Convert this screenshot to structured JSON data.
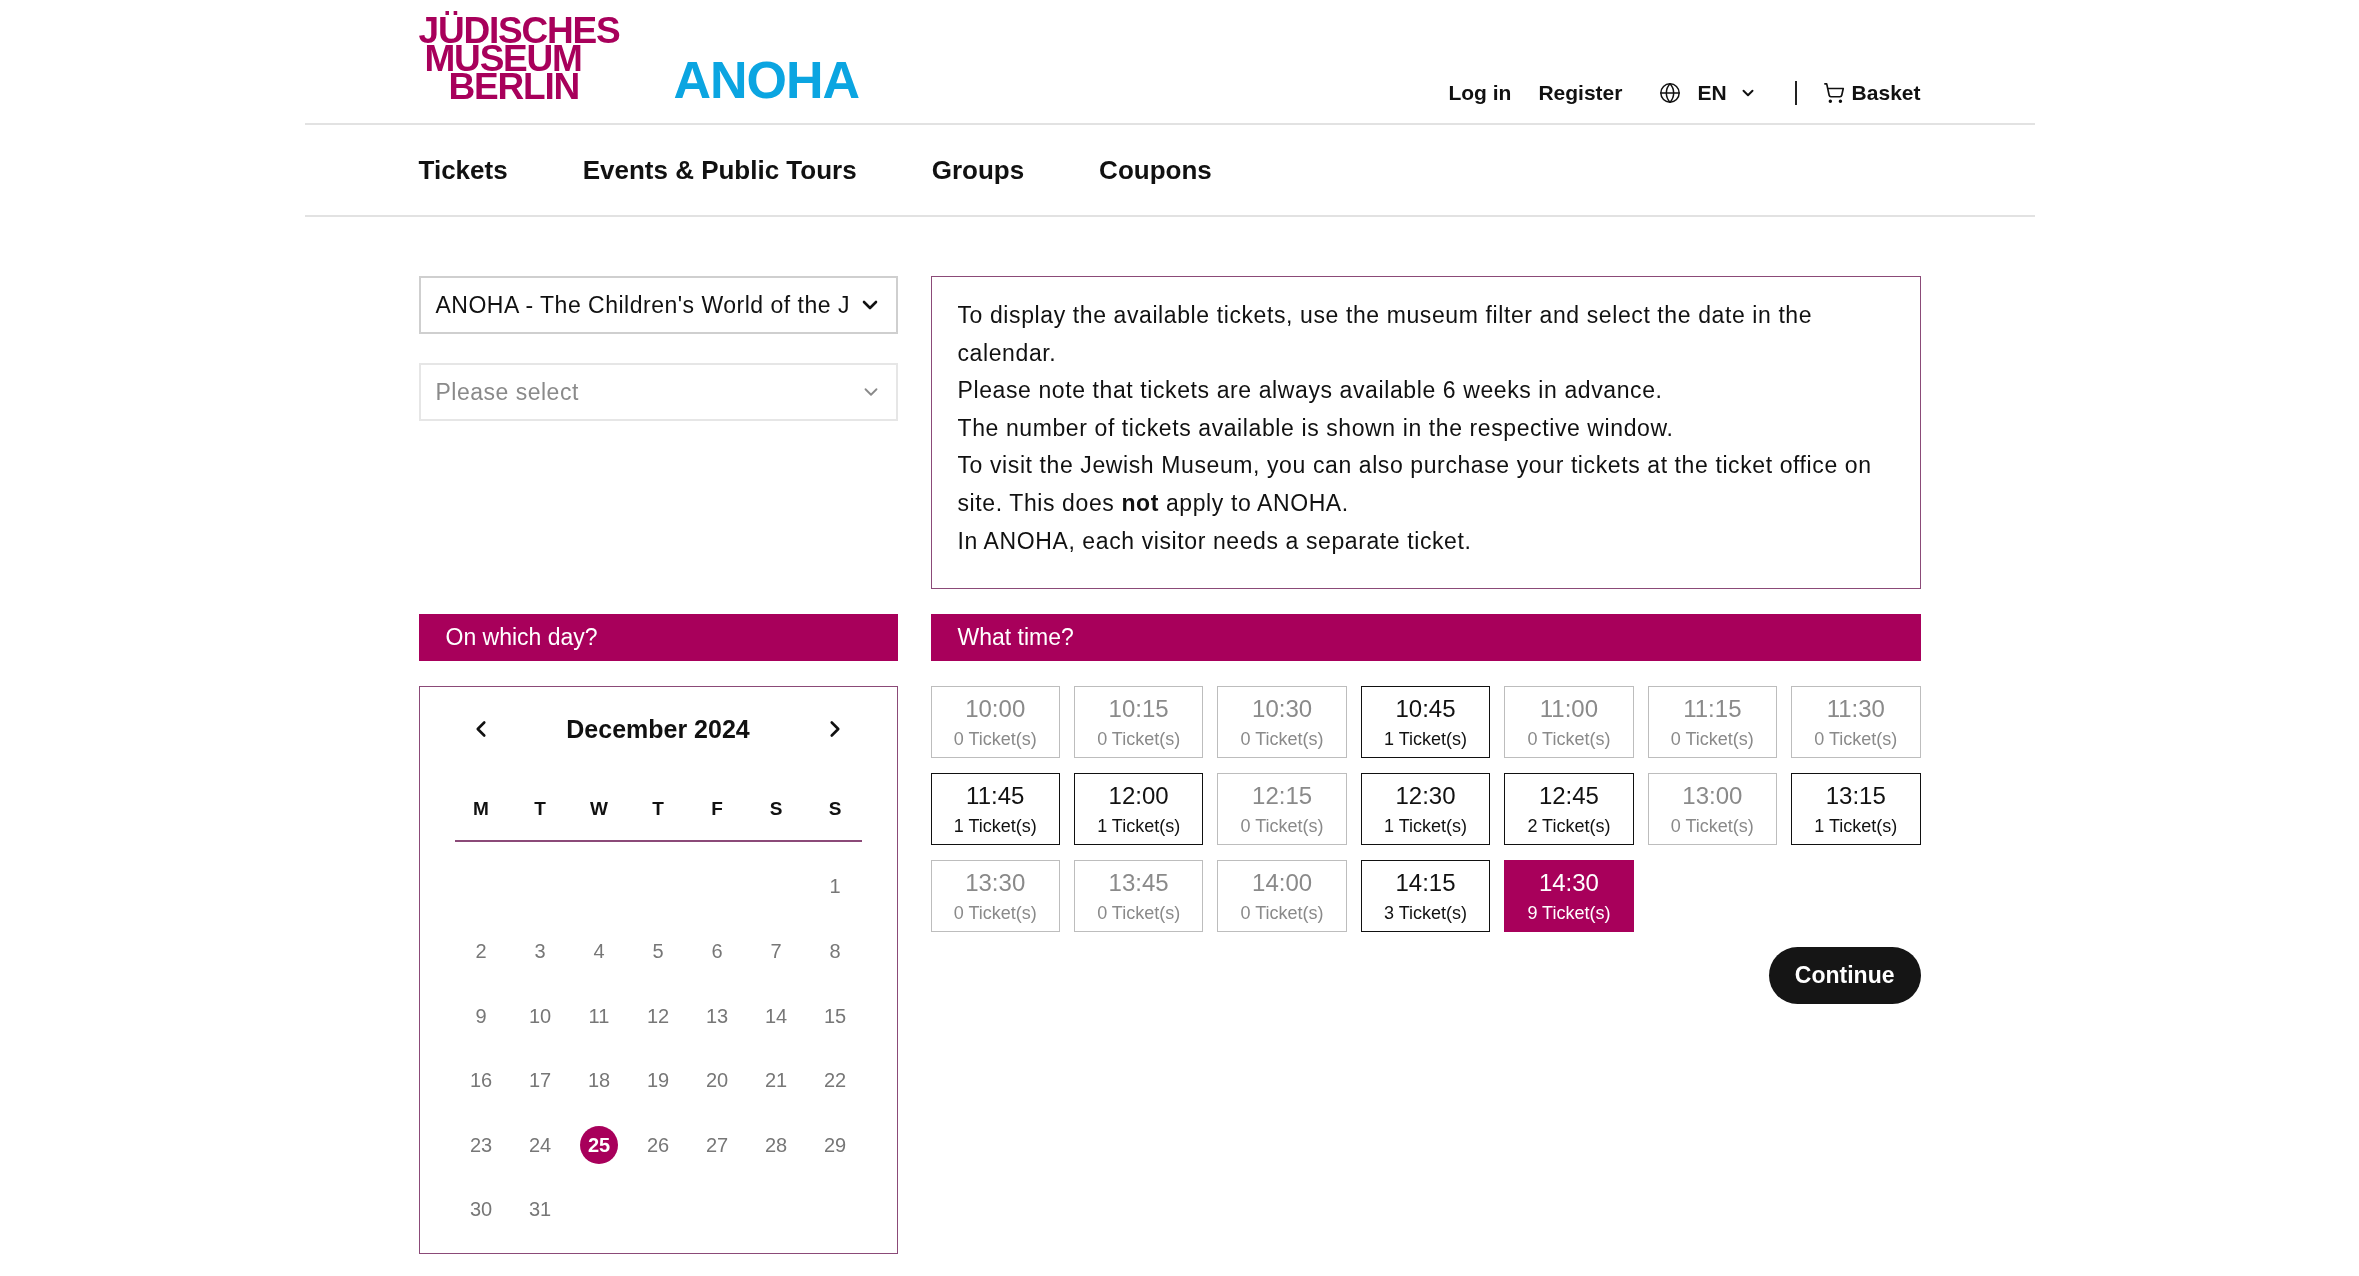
{
  "header": {
    "logo": [
      "JÜDISCHES",
      "MUSEUM",
      "BERLIN"
    ],
    "wordmark": "ANOHA",
    "links": [
      "Log in",
      "Register"
    ],
    "language": "EN",
    "basket": "Basket"
  },
  "nav": {
    "items": [
      "Tickets",
      "Events & Public Tours",
      "Groups",
      "Coupons"
    ]
  },
  "filters": [
    {
      "value": "ANOHA - The Children's World of the J"
    },
    {
      "placeholder": "Please select"
    }
  ],
  "info": {
    "paragraphs": [
      "To display the available tickets, use the museum filter and select the date in the calendar.",
      "Please note that tickets are always available 6 weeks in advance.",
      "The number of tickets available is shown in the respective window.",
      "To visit the Jewish Museum, you can also purchase your tickets at the ticket office on site. This does **not** apply to ANOHA.",
      "In ANOHA, each visitor needs a separate ticket."
    ]
  },
  "day_picker": {
    "title": "On which day?",
    "month": "December 2024",
    "weekdays": [
      "M",
      "T",
      "W",
      "T",
      "F",
      "S",
      "S"
    ],
    "weeks": [
      {
        "days": [
          {
            "day": "1",
            "selected": false
          }
        ]
      },
      {
        "days": [
          {
            "day": "2",
            "selected": false
          },
          {
            "day": "3",
            "selected": false
          },
          {
            "day": "4",
            "selected": false
          },
          {
            "day": "5",
            "selected": false
          },
          {
            "day": "6",
            "selected": false
          },
          {
            "day": "7",
            "selected": false
          },
          {
            "day": "8",
            "selected": false
          }
        ]
      },
      {
        "days": [
          {
            "day": "9",
            "selected": false
          },
          {
            "day": "10",
            "selected": false
          },
          {
            "day": "11",
            "selected": false
          },
          {
            "day": "12",
            "selected": false
          },
          {
            "day": "13",
            "selected": false
          },
          {
            "day": "14",
            "selected": false
          },
          {
            "day": "15",
            "selected": false
          }
        ]
      },
      {
        "days": [
          {
            "day": "16",
            "selected": false
          },
          {
            "day": "17",
            "selected": false
          },
          {
            "day": "18",
            "selected": false
          },
          {
            "day": "19",
            "selected": false
          },
          {
            "day": "20",
            "selected": false
          },
          {
            "day": "21",
            "selected": false
          },
          {
            "day": "22",
            "selected": false
          }
        ]
      },
      {
        "days": [
          {
            "day": "23",
            "selected": false
          },
          {
            "day": "24",
            "selected": false
          },
          {
            "day": "25",
            "selected": true
          },
          {
            "day": "26",
            "selected": false
          },
          {
            "day": "27",
            "selected": false
          },
          {
            "day": "28",
            "selected": false
          },
          {
            "day": "29",
            "selected": false
          }
        ]
      },
      {
        "days": [
          {
            "day": "30",
            "selected": false
          },
          {
            "day": "31",
            "selected": false
          }
        ]
      }
    ]
  },
  "time_picker": {
    "title": "What time?",
    "slots": [
      {
        "time": "10:00",
        "tickets": "0 Ticket(s)",
        "disabled": true,
        "selected": false
      },
      {
        "time": "10:15",
        "tickets": "0 Ticket(s)",
        "disabled": true,
        "selected": false
      },
      {
        "time": "10:30",
        "tickets": "0 Ticket(s)",
        "disabled": true,
        "selected": false
      },
      {
        "time": "10:45",
        "tickets": "1 Ticket(s)",
        "disabled": false,
        "selected": false
      },
      {
        "time": "11:00",
        "tickets": "0 Ticket(s)",
        "disabled": true,
        "selected": false
      },
      {
        "time": "11:15",
        "tickets": "0 Ticket(s)",
        "disabled": true,
        "selected": false
      },
      {
        "time": "11:30",
        "tickets": "0 Ticket(s)",
        "disabled": true,
        "selected": false
      },
      {
        "time": "11:45",
        "tickets": "1 Ticket(s)",
        "disabled": false,
        "selected": false
      },
      {
        "time": "12:00",
        "tickets": "1 Ticket(s)",
        "disabled": false,
        "selected": false
      },
      {
        "time": "12:15",
        "tickets": "0 Ticket(s)",
        "disabled": true,
        "selected": false
      },
      {
        "time": "12:30",
        "tickets": "1 Ticket(s)",
        "disabled": false,
        "selected": false
      },
      {
        "time": "12:45",
        "tickets": "2 Ticket(s)",
        "disabled": false,
        "selected": false
      },
      {
        "time": "13:00",
        "tickets": "0 Ticket(s)",
        "disabled": true,
        "selected": false
      },
      {
        "time": "13:15",
        "tickets": "1 Ticket(s)",
        "disabled": false,
        "selected": false
      },
      {
        "time": "13:30",
        "tickets": "0 Ticket(s)",
        "disabled": true,
        "selected": false
      },
      {
        "time": "13:45",
        "tickets": "0 Ticket(s)",
        "disabled": true,
        "selected": false
      },
      {
        "time": "14:00",
        "tickets": "0 Ticket(s)",
        "disabled": true,
        "selected": false
      },
      {
        "time": "14:15",
        "tickets": "3 Ticket(s)",
        "disabled": false,
        "selected": false
      },
      {
        "time": "14:30",
        "tickets": "9 Ticket(s)",
        "disabled": false,
        "selected": true
      }
    ]
  },
  "continue_button": "Continue"
}
